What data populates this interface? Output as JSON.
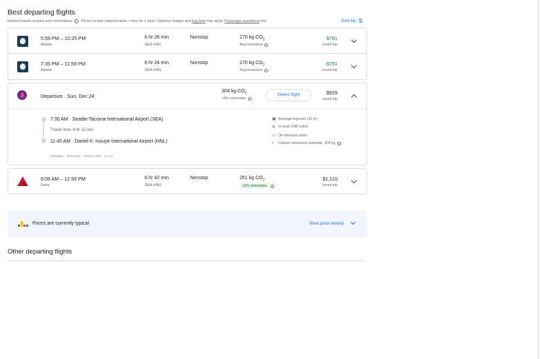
{
  "section": {
    "title": "Best departing flights",
    "ranked_text": "Ranked based on price and convenience",
    "prices_text_pre": "Prices include required taxes + fees for 1 adult. Optional charges and",
    "bag_fees_link": "bag fees",
    "prices_text_mid": "may apply.",
    "assistance_link": "Passenger assistance",
    "prices_text_post": "info.",
    "sort_label": "Sort by:",
    "sort_icon": "sort-arrows-icon"
  },
  "flights": [
    {
      "airline": "Alaska",
      "times": "5:59 PM – 10:25 PM",
      "duration": "6 hr 26 min",
      "route": "SEA–HNL",
      "stops": "Nonstop",
      "co2_value": "270 kg CO",
      "co2_sub": "2",
      "emissions": "Avg emissions",
      "price": "$781",
      "price_type": "round trip",
      "price_color": "#188038",
      "logo_icon": "alaska-logo-icon"
    },
    {
      "airline": "Alaska",
      "times": "7:35 PM – 11:59 PM",
      "duration": "6 hr 24 min",
      "route": "SEA–HNL",
      "stops": "Nonstop",
      "co2_value": "270 kg CO",
      "co2_sub": "2",
      "emissions": "Avg emissions",
      "price": "$781",
      "price_type": "round trip",
      "price_color": "#188038",
      "logo_icon": "alaska-logo-icon"
    }
  ],
  "expanded": {
    "departure_label": "Departure",
    "date": "Sun, Dec 24",
    "co2_value": "304 kg CO",
    "co2_sub": "2",
    "emissions": "+8% emissions",
    "select_label": "Select flight",
    "price": "$929",
    "price_type": "round trip",
    "dep_time": "7:30 AM",
    "dep_airport": "Seattle-Tacoma International Airport (SEA)",
    "travel_time": "Travel time: 6 hr 15 min",
    "arr_time": "11:45 AM",
    "arr_airport": "Daniel K. Inouye International Airport (HNL)",
    "meta": "Hawaiian · Economy · Airbus A330 · HA 21",
    "amenities": [
      {
        "icon": "seat-icon",
        "text": "Average legroom (31 in)"
      },
      {
        "icon": "usb-icon",
        "text": "In-seat USB outlet"
      },
      {
        "icon": "video-icon",
        "text": "On-demand video"
      },
      {
        "icon": "co2-icon",
        "text": "Carbon emissions estimate: 304 kg"
      }
    ],
    "logo_icon": "hawaiian-logo-icon"
  },
  "delta_flight": {
    "airline": "Delta",
    "times": "8:08 AM – 12:50 PM",
    "duration": "6 hr 42 min",
    "route": "SEA–HNL",
    "stops": "Nonstop",
    "co2_value": "251 kg CO",
    "co2_sub": "2",
    "emissions": "-11% emissions",
    "price": "$1,110",
    "price_type": "round trip",
    "logo_icon": "delta-logo-icon"
  },
  "price_panel": {
    "text": "Prices are currently typical",
    "link": "View price history",
    "bar_colors": [
      "#1e8e3e",
      "#fbbc04",
      "#ea4335",
      "#1a73e8"
    ]
  },
  "other": {
    "title": "Other departing flights"
  }
}
